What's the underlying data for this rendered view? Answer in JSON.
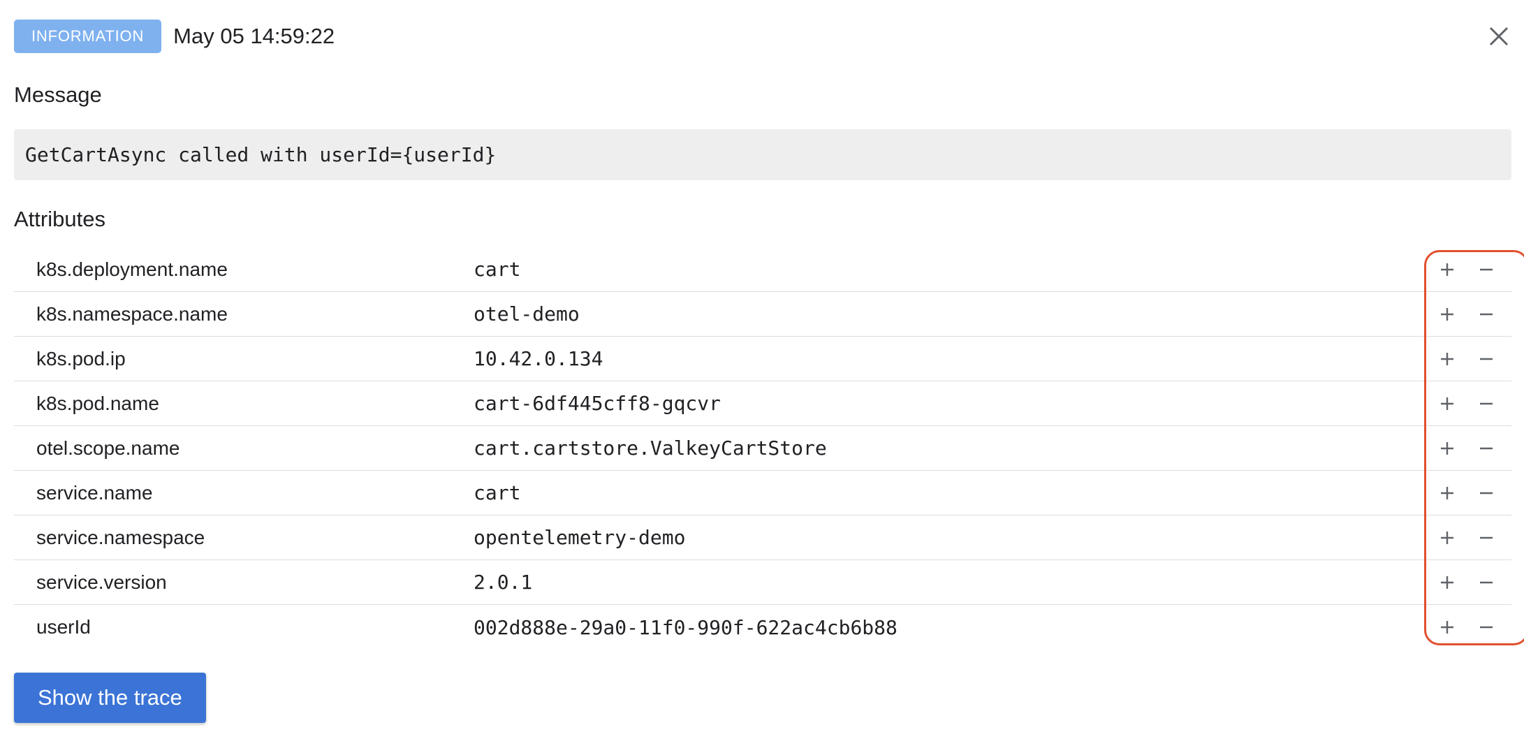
{
  "header": {
    "level_badge": "INFORMATION",
    "timestamp": "May 05 14:59:22",
    "close_icon": "close-icon"
  },
  "message_section": {
    "title": "Message",
    "text": "GetCartAsync called with userId={userId}"
  },
  "attributes_section": {
    "title": "Attributes",
    "rows": [
      {
        "key": "k8s.deployment.name",
        "value": "cart"
      },
      {
        "key": "k8s.namespace.name",
        "value": "otel-demo"
      },
      {
        "key": "k8s.pod.ip",
        "value": "10.42.0.134"
      },
      {
        "key": "k8s.pod.name",
        "value": "cart-6df445cff8-gqcvr"
      },
      {
        "key": "otel.scope.name",
        "value": "cart.cartstore.ValkeyCartStore"
      },
      {
        "key": "service.name",
        "value": "cart"
      },
      {
        "key": "service.namespace",
        "value": "opentelemetry-demo"
      },
      {
        "key": "service.version",
        "value": "2.0.1"
      },
      {
        "key": "userId",
        "value": "002d888e-29a0-11f0-990f-622ac4cb6b88"
      }
    ],
    "row_actions": [
      "plus-icon",
      "minus-icon"
    ]
  },
  "footer": {
    "trace_button_label": "Show the trace"
  },
  "colors": {
    "badge_bg": "#7fb1ef",
    "message_bg": "#eeeeee",
    "primary_button": "#3b74d6",
    "highlight_outline": "#e0502e"
  }
}
